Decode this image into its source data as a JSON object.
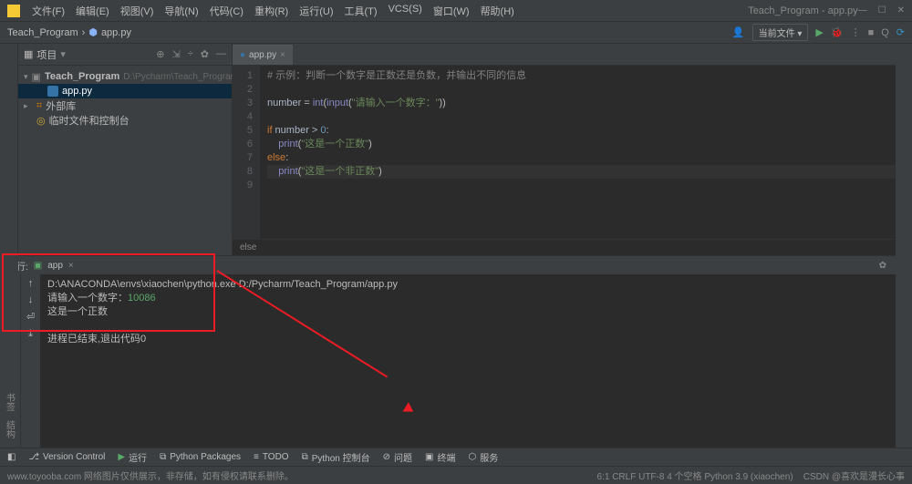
{
  "titlebar": {
    "app_title": "Teach_Program - app.py",
    "menus": [
      "文件(F)",
      "编辑(E)",
      "视图(V)",
      "导航(N)",
      "代码(C)",
      "重构(R)",
      "运行(U)",
      "工具(T)",
      "VCS(S)",
      "窗口(W)",
      "帮助(H)"
    ]
  },
  "breadcrumb": {
    "project": "Teach_Program",
    "file": "app.py"
  },
  "toolbar": {
    "config_label": "当前文件",
    "run_icon": "▶",
    "debug_icon": "🐞"
  },
  "project_panel": {
    "title": "项目",
    "root": "Teach_Program",
    "root_hint": "D:\\Pycharm\\Teach_Program",
    "file": "app.py",
    "external": "外部库",
    "scratch": "临时文件和控制台"
  },
  "editor": {
    "tab": "app.py",
    "line_numbers": [
      "1",
      "2",
      "3",
      "4",
      "5",
      "6",
      "7",
      "8",
      "9"
    ],
    "lines": [
      {
        "type": "cmt",
        "text": "# 示例：判断一个数字是正数还是负数，并输出不同的信息"
      },
      {
        "type": "blank",
        "text": ""
      },
      {
        "type": "assign",
        "parts": [
          "number",
          " = ",
          "int",
          "(",
          "input",
          "(",
          "\"请输入一个数字：\"",
          "))"
        ]
      },
      {
        "type": "blank",
        "text": ""
      },
      {
        "type": "if",
        "parts": [
          "if",
          " number > ",
          "0",
          ":"
        ]
      },
      {
        "type": "stmt",
        "indent": 1,
        "parts": [
          "print",
          "(",
          "\"这是一个正数\"",
          ")"
        ]
      },
      {
        "type": "else",
        "parts": [
          "else",
          ":"
        ]
      },
      {
        "type": "stmt",
        "indent": 1,
        "hl": true,
        "parts": [
          "print",
          "(",
          "\"这是一个非正数\"",
          ")"
        ]
      },
      {
        "type": "blank",
        "text": ""
      }
    ],
    "crumb": "else"
  },
  "run_panel": {
    "title": "运行:",
    "tab": "app",
    "cmd": "D:\\ANACONDA\\envs\\xiaochen\\python.exe D:/Pycharm/Teach_Program/app.py",
    "prompt": "请输入一个数字：",
    "input": "10086",
    "output": "这是一个正数",
    "exit": "进程已结束,退出代码0"
  },
  "bottom_tools": {
    "items": [
      "Version Control",
      "运行",
      "Python Packages",
      "TODO",
      "Python 控制台",
      "问题",
      "终端",
      "服务"
    ]
  },
  "statusbar": {
    "left_watermark": "www.toyooba.com 网络图片仅供展示，非存储，如有侵权请联系删除。",
    "right": "6:1   CRLF   UTF-8   4 个空格   Python 3.9 (xiaochen)",
    "csdn": "CSDN @喜欢是漫长心事"
  },
  "chart_data": null
}
